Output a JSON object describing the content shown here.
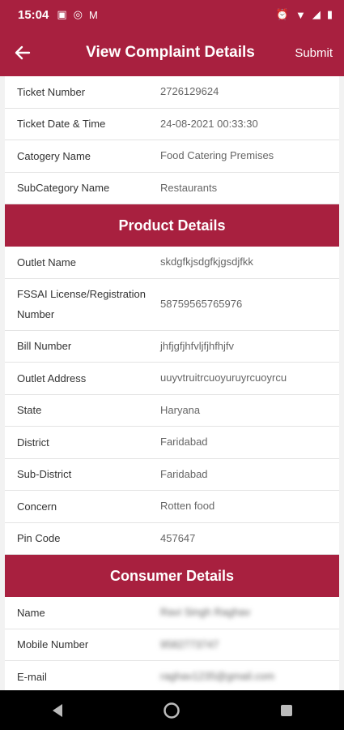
{
  "status": {
    "time": "15:04",
    "left_icons": [
      "image-icon",
      "whatsapp-icon",
      "gmail-icon"
    ],
    "right_icons": [
      "alarm-icon",
      "wifi-icon",
      "signal-icon",
      "battery-icon"
    ]
  },
  "appbar": {
    "title": "View Complaint Details",
    "submit_label": "Submit"
  },
  "ticket": [
    {
      "label": "Ticket Number",
      "value": "2726129624"
    },
    {
      "label": "Ticket Date & Time",
      "value": "24-08-2021 00:33:30"
    },
    {
      "label": "Catogery Name",
      "value": "Food Catering Premises"
    },
    {
      "label": "SubCategory Name",
      "value": "Restaurants"
    }
  ],
  "product": {
    "title": "Product Details",
    "rows": [
      {
        "label": "Outlet Name",
        "value": "skdgfkjsdgfkjgsdjfkk"
      },
      {
        "label": "FSSAI License/Registration Number",
        "value": "58759565765976"
      },
      {
        "label": "Bill Number",
        "value": "jhfjgfjhfvljfjhfhjfv"
      },
      {
        "label": "Outlet Address",
        "value": "uuyvtruitrcuoyuruyrcuoyrcu"
      },
      {
        "label": "State",
        "value": "Haryana"
      },
      {
        "label": "District",
        "value": "Faridabad"
      },
      {
        "label": "Sub-District",
        "value": "Faridabad"
      },
      {
        "label": "Concern",
        "value": "Rotten food"
      },
      {
        "label": "Pin Code",
        "value": "457647"
      }
    ]
  },
  "consumer": {
    "title": "Consumer Details",
    "rows": [
      {
        "label": "Name",
        "value": "Ravi Singh Raghav"
      },
      {
        "label": "Mobile Number",
        "value": "9582773747"
      },
      {
        "label": "E-mail",
        "value": "raghav1235@gmail.com"
      }
    ]
  },
  "colors": {
    "primary": "#a8203f"
  }
}
